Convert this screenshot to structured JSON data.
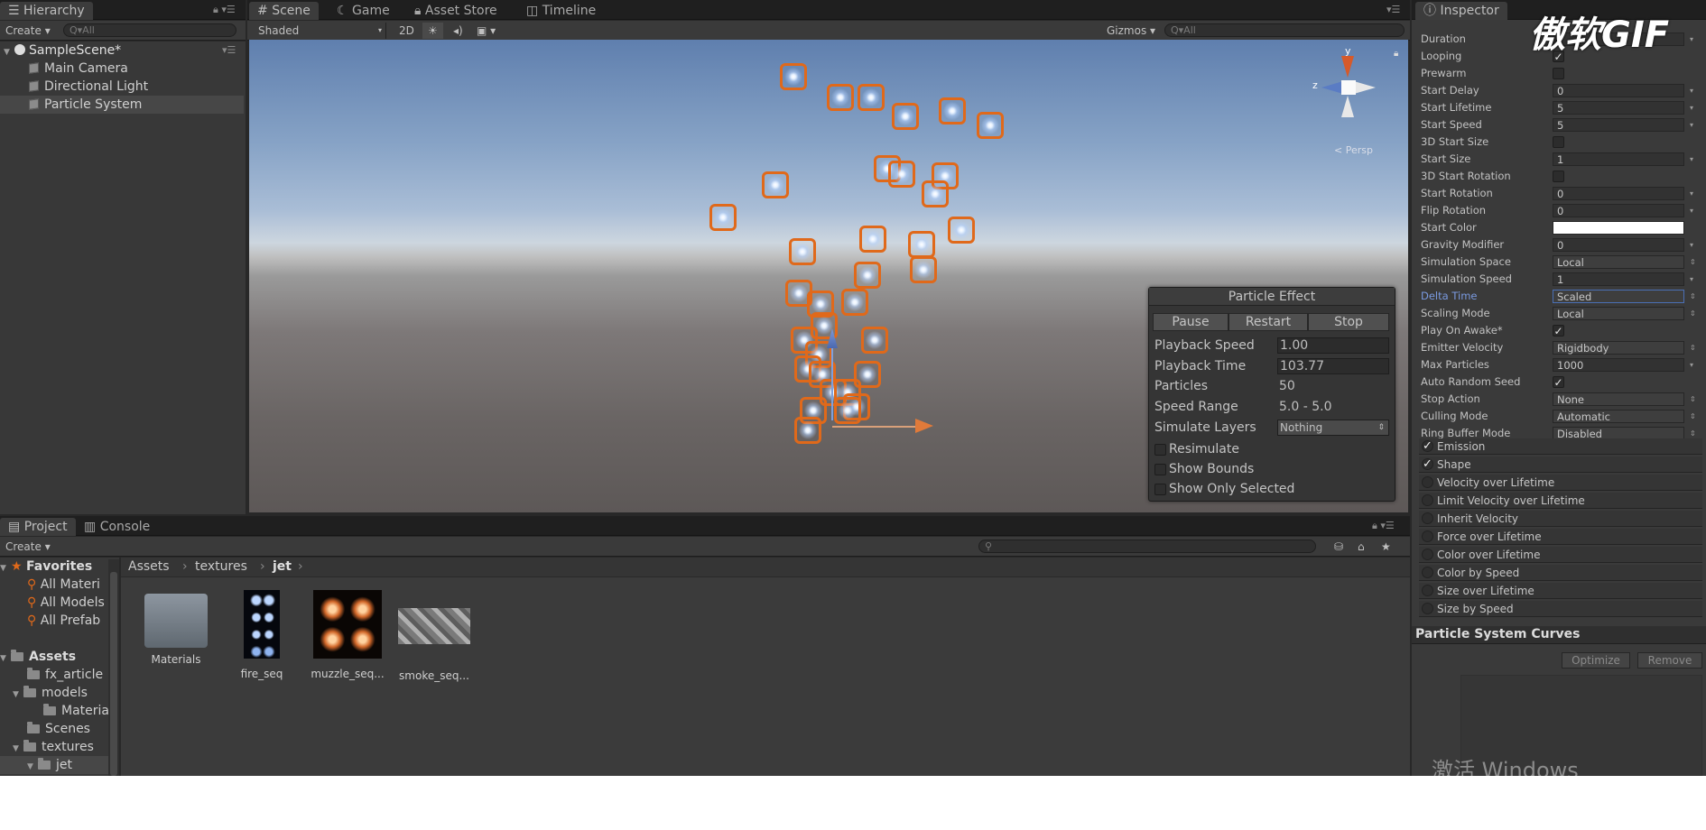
{
  "hierarchy": {
    "tab": "Hierarchy",
    "create": "Create",
    "search_placeholder": "Q▾All",
    "scene_name": "SampleScene*",
    "items": [
      "Main Camera",
      "Directional Light",
      "Particle System"
    ],
    "selected": "Particle System"
  },
  "scene_tabs": {
    "scene": "Scene",
    "game": "Game",
    "asset_store": "Asset Store",
    "timeline": "Timeline"
  },
  "scene_toolbar": {
    "shading": "Shaded",
    "mode_2d": "2D",
    "gizmos": "Gizmos",
    "search_placeholder": "Q▾All"
  },
  "gizmo": {
    "y": "y",
    "z": "z",
    "persp": "< Persp"
  },
  "particle_effect": {
    "title": "Particle Effect",
    "buttons": [
      "Pause",
      "Restart",
      "Stop"
    ],
    "playback_speed": {
      "label": "Playback Speed",
      "value": "1.00"
    },
    "playback_time": {
      "label": "Playback Time",
      "value": "103.77"
    },
    "particles": {
      "label": "Particles",
      "value": "50"
    },
    "speed_range": {
      "label": "Speed Range",
      "value": "5.0 - 5.0"
    },
    "simulate_layers": {
      "label": "Simulate Layers",
      "value": "Nothing"
    },
    "checks": [
      "Resimulate",
      "Show Bounds",
      "Show Only Selected"
    ]
  },
  "inspector": {
    "tab": "Inspector",
    "rows": [
      {
        "label": "Duration",
        "value": "",
        "kind": "text"
      },
      {
        "label": "Looping",
        "value": "✓",
        "kind": "check"
      },
      {
        "label": "Prewarm",
        "value": "",
        "kind": "check"
      },
      {
        "label": "Start Delay",
        "value": "0",
        "kind": "text"
      },
      {
        "label": "Start Lifetime",
        "value": "5",
        "kind": "text"
      },
      {
        "label": "Start Speed",
        "value": "5",
        "kind": "text"
      },
      {
        "label": "3D Start Size",
        "value": "",
        "kind": "check"
      },
      {
        "label": "Start Size",
        "value": "1",
        "kind": "text"
      },
      {
        "label": "3D Start Rotation",
        "value": "",
        "kind": "check"
      },
      {
        "label": "Start Rotation",
        "value": "0",
        "kind": "text"
      },
      {
        "label": "Flip Rotation",
        "value": "0",
        "kind": "text"
      },
      {
        "label": "Start Color",
        "value": "",
        "kind": "color"
      },
      {
        "label": "Gravity Modifier",
        "value": "0",
        "kind": "text"
      },
      {
        "label": "Simulation Space",
        "value": "Local",
        "kind": "drop"
      },
      {
        "label": "Simulation Speed",
        "value": "1",
        "kind": "text"
      },
      {
        "label": "Delta Time",
        "value": "Scaled",
        "kind": "drop"
      },
      {
        "label": "Scaling Mode",
        "value": "Local",
        "kind": "drop"
      },
      {
        "label": "Play On Awake*",
        "value": "✓",
        "kind": "check"
      },
      {
        "label": "Emitter Velocity",
        "value": "Rigidbody",
        "kind": "drop"
      },
      {
        "label": "Max Particles",
        "value": "1000",
        "kind": "text"
      },
      {
        "label": "Auto Random Seed",
        "value": "✓",
        "kind": "check"
      },
      {
        "label": "Stop Action",
        "value": "None",
        "kind": "drop"
      },
      {
        "label": "Culling Mode",
        "value": "Automatic",
        "kind": "drop"
      },
      {
        "label": "Ring Buffer Mode",
        "value": "Disabled",
        "kind": "drop"
      }
    ],
    "modules": [
      {
        "name": "Emission",
        "enabled": "✓"
      },
      {
        "name": "Shape",
        "enabled": "✓"
      },
      {
        "name": "Velocity over Lifetime",
        "enabled": ""
      },
      {
        "name": "Limit Velocity over Lifetime",
        "enabled": ""
      },
      {
        "name": "Inherit Velocity",
        "enabled": ""
      },
      {
        "name": "Force over Lifetime",
        "enabled": ""
      },
      {
        "name": "Color over Lifetime",
        "enabled": ""
      },
      {
        "name": "Color by Speed",
        "enabled": ""
      },
      {
        "name": "Size over Lifetime",
        "enabled": ""
      },
      {
        "name": "Size by Speed",
        "enabled": ""
      }
    ],
    "curves_title": "Particle System Curves",
    "optimize": "Optimize",
    "remove": "Remove"
  },
  "project": {
    "tabs": [
      "Project",
      "Console"
    ],
    "create": "Create",
    "tree": {
      "favorites": "Favorites",
      "fav_items": [
        "All Materi",
        "All Models",
        "All Prefab"
      ],
      "assets": "Assets",
      "asset_items": [
        "fx_article",
        "models",
        "Materia",
        "Scenes",
        "textures",
        "jet"
      ]
    },
    "breadcrumb": [
      "Assets",
      "textures",
      "jet"
    ],
    "assets": [
      "Materials",
      "fire_seq",
      "muzzle_seq...",
      "smoke_seq..."
    ]
  },
  "watermarks": {
    "brand": "傲软GIF",
    "windows": "激活 Windows"
  },
  "colors": {
    "accent": "#e0691a",
    "selection": "#4a6fb5"
  }
}
